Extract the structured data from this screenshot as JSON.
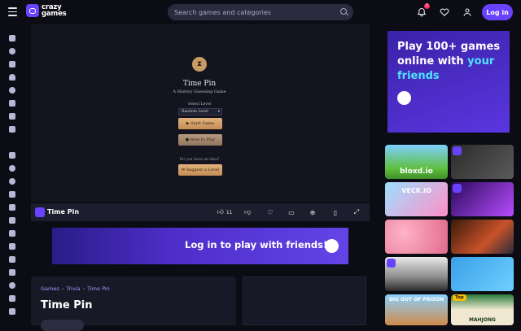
{
  "topbar": {
    "logo_line1": "crazy",
    "logo_line2": "games",
    "search_placeholder": "Search games and categories",
    "notifications_count": "1",
    "login_label": "Log in"
  },
  "game": {
    "title": "Time Pin",
    "subtitle": "A History Guessing Game",
    "select_label": "Select Level",
    "select_value": "Random Level",
    "start_label": "Start Game",
    "howto_label": "How to Play",
    "hint": "Do you have an idea?",
    "suggest_label": "Suggest a Level"
  },
  "gamebar": {
    "title": "Time Pin",
    "likes": "11"
  },
  "promo_banner": {
    "text": "Log in to play with friends!"
  },
  "info": {
    "breadcrumb": [
      "Games",
      "Trivia",
      "Time Pin"
    ],
    "title": "Time Pin"
  },
  "right_promo": {
    "line1": "Play 100+ games",
    "line2": "online with",
    "highlight": "your",
    "line3": "friends"
  },
  "tiles": [
    {
      "label": "bloxd.io"
    },
    {
      "label": ""
    },
    {
      "label": "VECK.IO"
    },
    {
      "label": ""
    },
    {
      "label": ""
    },
    {
      "label": ""
    },
    {
      "label": ""
    },
    {
      "label": ""
    },
    {
      "label": "DIG OUT OF PRISON"
    },
    {
      "label": "MAHJONG",
      "badge": "Top"
    }
  ],
  "colors": {
    "accent": "#6842ff",
    "background": "#0c0d14",
    "highlight": "#4ee3ff"
  }
}
